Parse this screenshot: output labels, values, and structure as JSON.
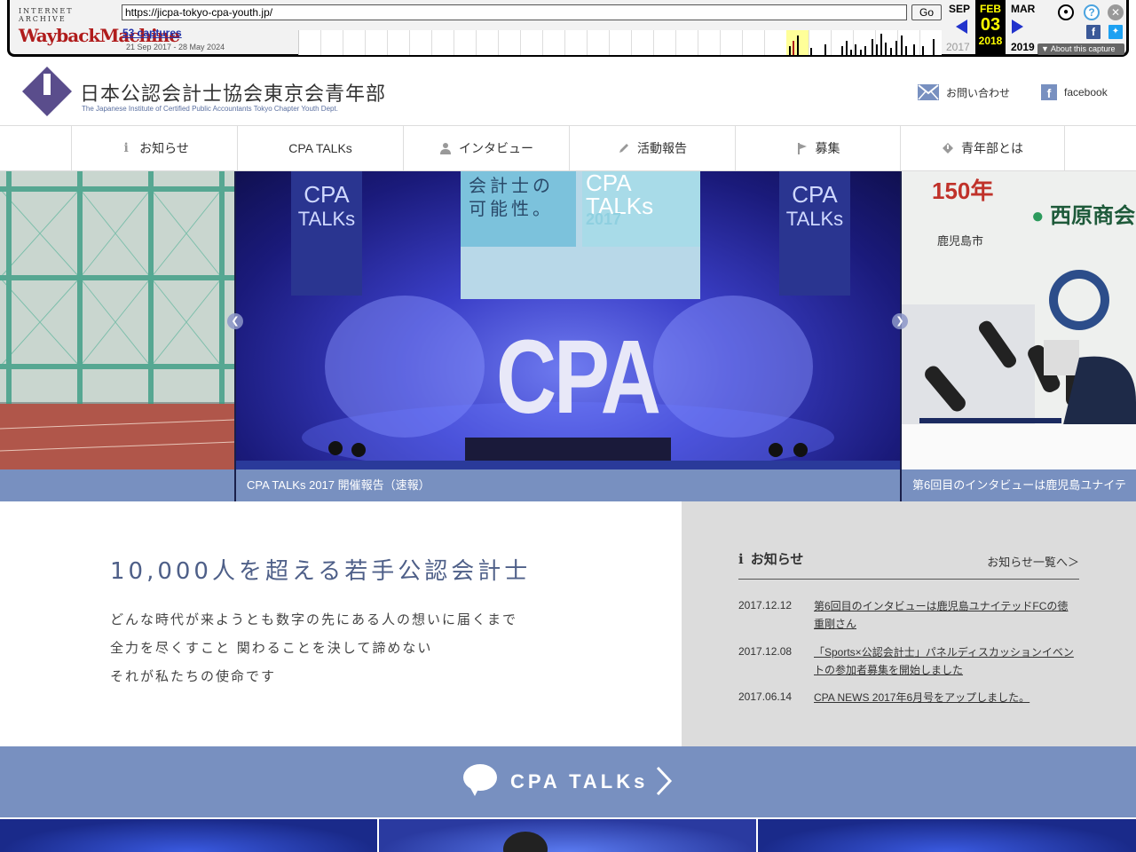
{
  "wayback": {
    "logo_top": "INTERNET ARCHIVE",
    "logo_main": "WaybackMachine",
    "url": "https://jicpa-tokyo-cpa-youth.jp/",
    "go_label": "Go",
    "captures": "53 captures",
    "range": "21 Sep 2017 - 28 May 2024",
    "prev_month": "SEP",
    "cur_month": "FEB",
    "next_month": "MAR",
    "cur_day": "03",
    "prev_year": "2017",
    "cur_year": "2018",
    "next_year": "2019",
    "about": "About this capture"
  },
  "header": {
    "title": "日本公認会計士協会東京会青年部",
    "subtitle": "The Japanese Institute of Certified Public Accountants Tokyo Chapter Youth Dept.",
    "contact": "お問い合わせ",
    "facebook": "facebook"
  },
  "nav": [
    {
      "label": "お知らせ",
      "icon": "info-icon"
    },
    {
      "label": "CPA TALKs",
      "icon": ""
    },
    {
      "label": "インタビュー",
      "icon": "person-icon"
    },
    {
      "label": "活動報告",
      "icon": "pencil-icon"
    },
    {
      "label": "募集",
      "icon": "flag-icon"
    },
    {
      "label": "青年部とは",
      "icon": "diamond-icon"
    }
  ],
  "slider": {
    "center_caption": "CPA TALKs 2017 開催報告（速報）",
    "right_caption": "第6回目のインタビューは鹿児島ユナイテ",
    "stage_text": "CPA",
    "banner_text_1": "CPA",
    "banner_text_2": "TALKs",
    "screen_text": "会計士の可能性。",
    "screen_title": "CPA TALKs",
    "screen_year": "2017",
    "right_badge": "150年",
    "right_brand": "西原商会",
    "right_city": "鹿児島市"
  },
  "intro": {
    "heading": "10,000人を超える若手公認会計士",
    "line1": "どんな時代が来ようとも数字の先にある人の想いに届くまで",
    "line2": "全力を尽くすこと 関わることを決して諦めない",
    "line3": "それが私たちの使命です"
  },
  "news": {
    "title": "お知らせ",
    "more": "お知らせ一覧へ＞",
    "items": [
      {
        "date": "2017.12.12",
        "text": "第6回目のインタビューは鹿児島ユナイテッドFCの徳重剛さん"
      },
      {
        "date": "2017.12.08",
        "text": "「Sports×公認会計士」パネルディスカッションイベントの参加者募集を開始しました"
      },
      {
        "date": "2017.06.14",
        "text": "CPA NEWS 2017年6月号をアップしました。"
      }
    ]
  },
  "talks": {
    "label": "CPA TALKs"
  }
}
